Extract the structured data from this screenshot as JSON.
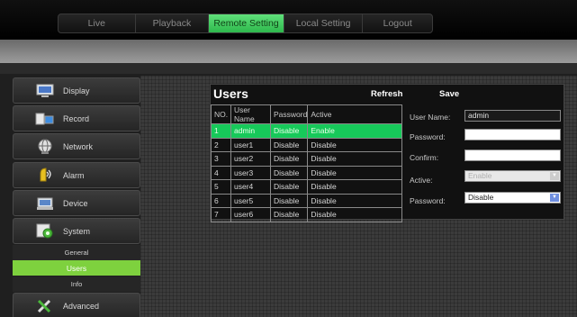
{
  "nav": {
    "items": [
      {
        "label": "Live"
      },
      {
        "label": "Playback"
      },
      {
        "label": "Remote Setting"
      },
      {
        "label": "Local Setting"
      },
      {
        "label": "Logout"
      }
    ],
    "active_index": 2,
    "active_color": "#2eb84c"
  },
  "sidebar": {
    "items": [
      {
        "label": "Display",
        "icon": "monitor-icon"
      },
      {
        "label": "Record",
        "icon": "camera-icon"
      },
      {
        "label": "Network",
        "icon": "globe-icon"
      },
      {
        "label": "Alarm",
        "icon": "alarm-icon"
      },
      {
        "label": "Device",
        "icon": "device-icon"
      },
      {
        "label": "System",
        "icon": "system-icon"
      },
      {
        "label": "Advanced",
        "icon": "tools-icon"
      }
    ],
    "subitems": [
      {
        "label": "General"
      },
      {
        "label": "Users"
      },
      {
        "label": "Info"
      }
    ],
    "active_subitem": "Users",
    "active_color": "#7ed13e"
  },
  "panel": {
    "title": "Users",
    "refresh_label": "Refresh",
    "save_label": "Save",
    "table": {
      "headers": [
        "NO.",
        "User Name",
        "Password",
        "Active"
      ],
      "rows": [
        [
          "1",
          "admin",
          "Disable",
          "Enable"
        ],
        [
          "2",
          "user1",
          "Disable",
          "Disable"
        ],
        [
          "3",
          "user2",
          "Disable",
          "Disable"
        ],
        [
          "4",
          "user3",
          "Disable",
          "Disable"
        ],
        [
          "5",
          "user4",
          "Disable",
          "Disable"
        ],
        [
          "6",
          "user5",
          "Disable",
          "Disable"
        ],
        [
          "7",
          "user6",
          "Disable",
          "Disable"
        ]
      ],
      "selected_row": 0,
      "selected_color": "#17c95a"
    },
    "form": {
      "username_label": "User Name:",
      "username_value": "admin",
      "password_label": "Password:",
      "password_value": "",
      "confirm_label": "Confirm:",
      "confirm_value": "",
      "active_label": "Active:",
      "active_value": "Enable",
      "password_mode_label": "Password:",
      "password_mode_value": "Disable"
    }
  }
}
